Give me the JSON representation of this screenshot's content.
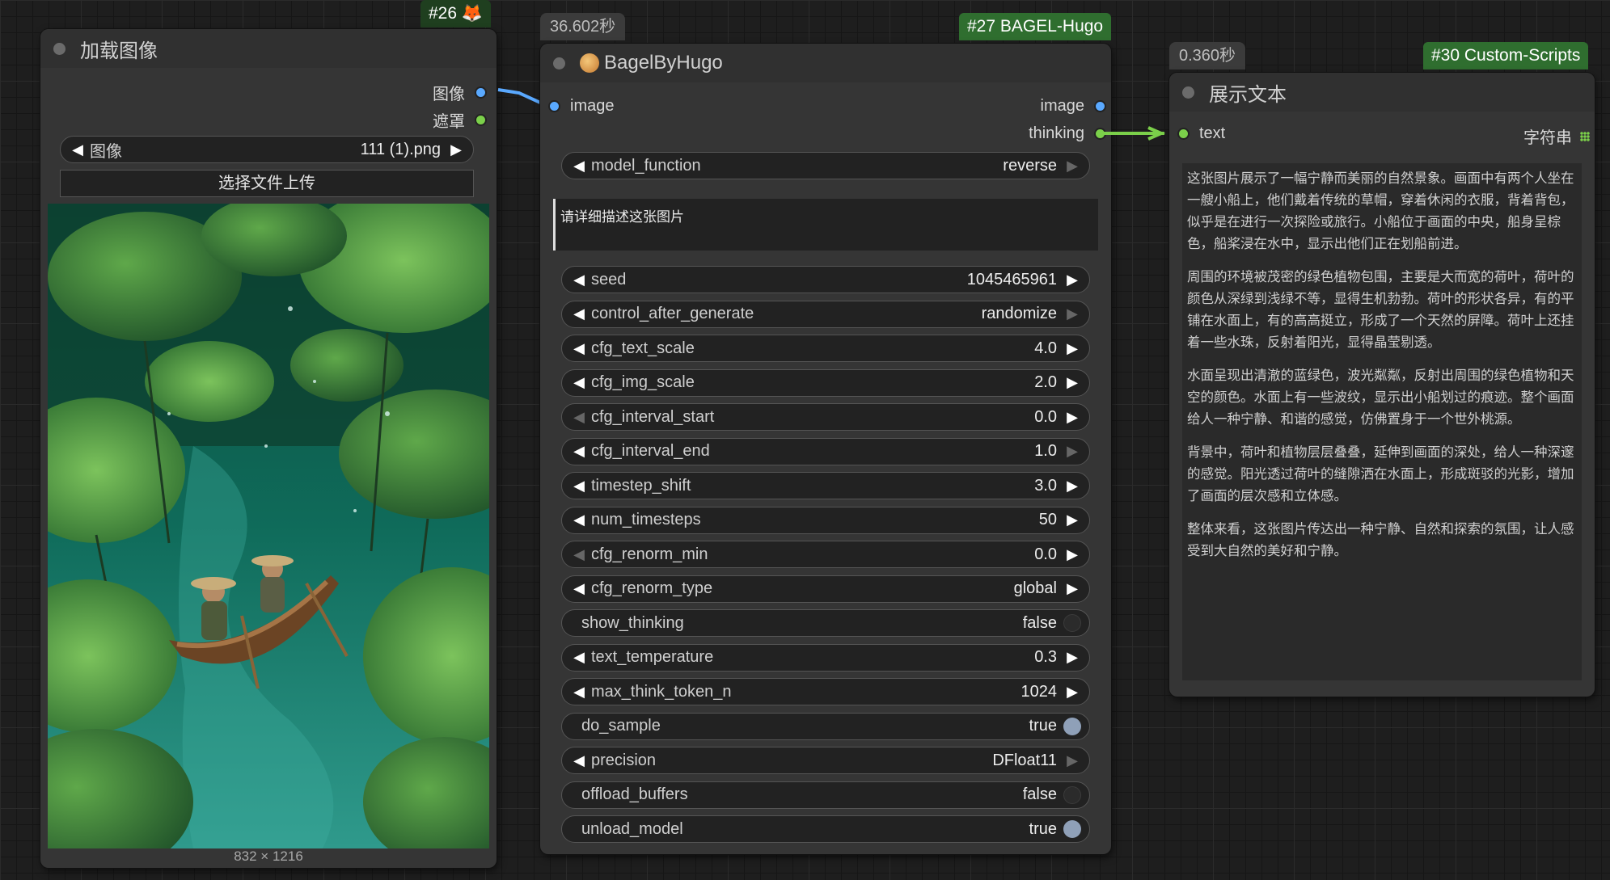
{
  "node26": {
    "badge": "#26 🦊",
    "title": "加载图像",
    "outputs": [
      "图像",
      "遮罩"
    ],
    "image_widget": {
      "label": "图像",
      "value": "111 (1).png"
    },
    "upload_button": "选择文件上传",
    "dimensions": "832 × 1216"
  },
  "node27": {
    "timer": "36.602秒",
    "badge": "#27 BAGEL-Hugo",
    "title": "BagelByHugo",
    "input": "image",
    "outputs": [
      "image",
      "thinking"
    ],
    "model_function": {
      "label": "model_function",
      "value": "reverse"
    },
    "prompt": "请详细描述这张图片",
    "widgets": [
      {
        "label": "seed",
        "value": "1045465961",
        "type": "number"
      },
      {
        "label": "control_after_generate",
        "value": "randomize",
        "type": "combo"
      },
      {
        "label": "cfg_text_scale",
        "value": "4.0",
        "type": "number"
      },
      {
        "label": "cfg_img_scale",
        "value": "2.0",
        "type": "number"
      },
      {
        "label": "cfg_interval_start",
        "value": "0.0",
        "type": "number"
      },
      {
        "label": "cfg_interval_end",
        "value": "1.0",
        "type": "number"
      },
      {
        "label": "timestep_shift",
        "value": "3.0",
        "type": "number"
      },
      {
        "label": "num_timesteps",
        "value": "50",
        "type": "number"
      },
      {
        "label": "cfg_renorm_min",
        "value": "0.0",
        "type": "number"
      },
      {
        "label": "cfg_renorm_type",
        "value": "global",
        "type": "combo"
      },
      {
        "label": "show_thinking",
        "value": "false",
        "type": "toggle"
      },
      {
        "label": "text_temperature",
        "value": "0.3",
        "type": "number"
      },
      {
        "label": "max_think_token_n",
        "value": "1024",
        "type": "number"
      },
      {
        "label": "do_sample",
        "value": "true",
        "type": "toggle"
      },
      {
        "label": "precision",
        "value": "DFloat11",
        "type": "combo"
      },
      {
        "label": "offload_buffers",
        "value": "false",
        "type": "toggle"
      },
      {
        "label": "unload_model",
        "value": "true",
        "type": "toggle"
      }
    ]
  },
  "node30": {
    "timer": "0.360秒",
    "badge": "#30 Custom-Scripts",
    "title": "展示文本",
    "input": "text",
    "output": "字符串",
    "paragraphs": [
      "这张图片展示了一幅宁静而美丽的自然景象。画面中有两个人坐在一艘小船上，他们戴着传统的草帽，穿着休闲的衣服，背着背包，似乎是在进行一次探险或旅行。小船位于画面的中央，船身呈棕色，船桨浸在水中，显示出他们正在划船前进。",
      "周围的环境被茂密的绿色植物包围，主要是大而宽的荷叶，荷叶的颜色从深绿到浅绿不等，显得生机勃勃。荷叶的形状各异，有的平铺在水面上，有的高高挺立，形成了一个天然的屏障。荷叶上还挂着一些水珠，反射着阳光，显得晶莹剔透。",
      "水面呈现出清澈的蓝绿色，波光粼粼，反射出周围的绿色植物和天空的颜色。水面上有一些波纹，显示出小船划过的痕迹。整个画面给人一种宁静、和谐的感觉，仿佛置身于一个世外桃源。",
      "背景中，荷叶和植物层层叠叠，延伸到画面的深处，给人一种深邃的感觉。阳光透过荷叶的缝隙洒在水面上，形成斑驳的光影，增加了画面的层次感和立体感。",
      "整体来看，这张图片传达出一种宁静、自然和探索的氛围，让人感受到大自然的美好和宁静。"
    ]
  },
  "colors": {
    "image_port": "#5aa9ff",
    "string_port": "#7bd04a",
    "canvas_bg": "#1e1e1e"
  }
}
